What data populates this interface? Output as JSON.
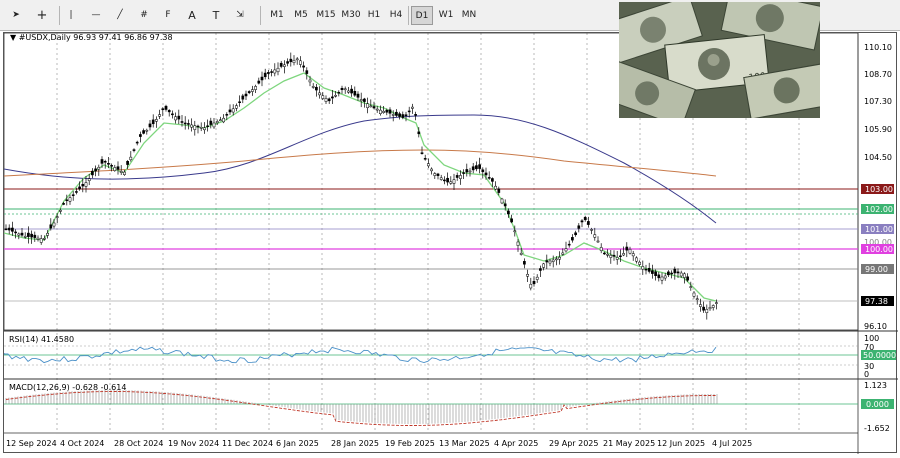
{
  "toolbar": {
    "tools": [
      {
        "name": "cursor-icon",
        "glyph": "➤"
      },
      {
        "name": "crosshair-icon",
        "glyph": "+"
      },
      {
        "name": "vertical-line-icon",
        "glyph": "|"
      },
      {
        "name": "horizontal-line-icon",
        "glyph": "—"
      },
      {
        "name": "trendline-icon",
        "glyph": "╱"
      },
      {
        "name": "equidistant-channel-icon",
        "glyph": "#"
      },
      {
        "name": "fibonacci-icon",
        "glyph": "F"
      },
      {
        "name": "text-icon",
        "glyph": "A"
      },
      {
        "name": "text-label-icon",
        "glyph": "T"
      },
      {
        "name": "arrows-icon",
        "glyph": "⇲"
      }
    ],
    "timeframes": [
      "M1",
      "M5",
      "M15",
      "M30",
      "H1",
      "H4",
      "D1",
      "W1",
      "MN"
    ],
    "active_timeframe": "D1"
  },
  "chart": {
    "symbol_header": "▼ #USDX,Daily  96.93 97.41 96.86 97.38",
    "price_labels": [
      "110.10",
      "108.70",
      "107.30",
      "105.90",
      "104.50",
      "103.00",
      "102.00",
      "101.00",
      "100.00",
      "99.00",
      "97.38",
      "96.10"
    ],
    "line_labels": [
      {
        "text": "103.00",
        "color": "#8b1a1a"
      },
      {
        "text": "102.00",
        "color": "#3cb371"
      },
      {
        "text": "101.00",
        "color": "#8a7fc0"
      },
      {
        "text": "100.00",
        "color": "#e040e0"
      },
      {
        "text": "99.00",
        "color": "#777777"
      },
      {
        "text": "97.38",
        "color": "#000000"
      }
    ],
    "faded_label": "100.00",
    "dates": [
      "12 Sep 2024",
      "4 Oct 2024",
      "28 Oct 2024",
      "19 Nov 2024",
      "11 Dec 2024",
      "6 Jan 2025",
      "28 Jan 2025",
      "19 Feb 2025",
      "13 Mar 2025",
      "4 Apr 2025",
      "29 Apr 2025",
      "21 May 2025",
      "12 Jun 2025",
      "4 Jul 2025"
    ]
  },
  "rsi": {
    "header": "RSI(14) 41.4580",
    "levels": [
      "100",
      "70",
      "30",
      "0"
    ],
    "current_label": "50.0000"
  },
  "macd": {
    "header": "MACD(12,26,9) -0.628 -0.614",
    "levels": [
      "1.123",
      "-1.652"
    ],
    "zero_label": "0.000"
  },
  "colors": {
    "ma_fast": "#7ed67e",
    "ma_mid": "#3a3a8c",
    "ma_slow": "#c87a4a",
    "candle": "#000000",
    "rsi": "#4a90c8",
    "macd_signal": "#c0392b"
  }
}
